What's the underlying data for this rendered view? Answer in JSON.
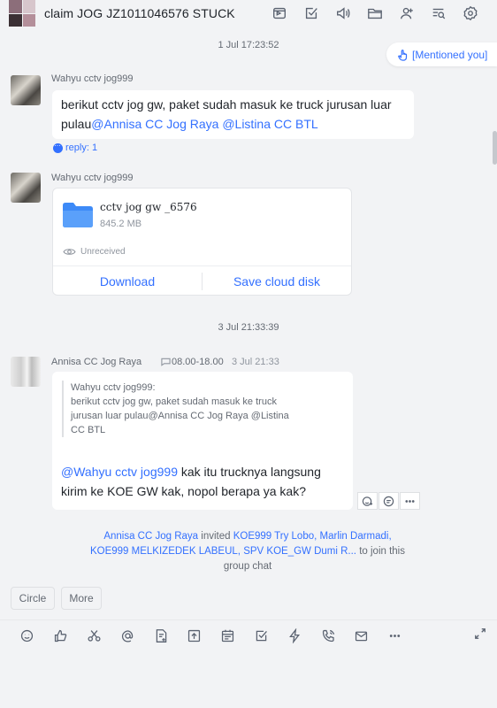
{
  "header": {
    "title": "claim JOG JZ1011046576 STUCK",
    "icons": [
      "video-call-icon",
      "task-icon",
      "announcement-icon",
      "folder-icon",
      "add-member-icon",
      "search-history-icon",
      "settings-icon"
    ]
  },
  "timestamps": {
    "first": "1 Jul 17:23:52",
    "second": "3 Jul 21:33:39"
  },
  "mention_notice": "[Mentioned you]",
  "messages": [
    {
      "sender": "Wahyu cctv jog999",
      "text_before": "berikut cctv jog gw, paket sudah masuk ke truck jurusan luar pulau",
      "mentions": [
        "@Annisa CC Jog Raya",
        " @Listina CC BTL"
      ],
      "reply": "reply: 1"
    },
    {
      "sender": "Wahyu cctv jog999",
      "file": {
        "name": "cctv jog gw _6576",
        "size": "845.2 MB",
        "status": "Unreceived",
        "download_label": "Download",
        "save_label": "Save cloud disk"
      }
    },
    {
      "sender": "Annisa CC Jog Raya",
      "work_hours": "08.00-18.00",
      "time": "3 Jul 21:33",
      "quote_lines": [
        "Wahyu cctv jog999:",
        "berikut cctv jog gw, paket sudah masuk ke truck",
        "jurusan luar pulau@Annisa CC Jog Raya @Listina",
        "CC BTL"
      ],
      "mention": "@Wahyu cctv jog999",
      "text_line1": " kak itu trucknya langsung",
      "text_line2": "kirim ke KOE GW kak, nopol berapa ya kak?"
    }
  ],
  "system_message": {
    "inviter": "Annisa CC Jog Raya",
    "invited_word": " invited ",
    "invitees_line1": "KOE999 Try Lobo, Marlin Darmadi,",
    "invitees_line2": "KOE999 MELKIZEDEK LABEUL, SPV KOE_GW Dumi R...",
    "suffix1": " to join this",
    "suffix2": "group chat"
  },
  "quick_buttons": [
    "Circle",
    "More"
  ],
  "toolbar_icons": [
    "emoji-icon",
    "thumbs-up-icon",
    "scissors-icon",
    "at-icon",
    "doc-icon",
    "upload-icon",
    "calendar-icon",
    "checkbox-icon",
    "lightning-icon",
    "phone-icon",
    "mail-icon",
    "more-icon"
  ]
}
